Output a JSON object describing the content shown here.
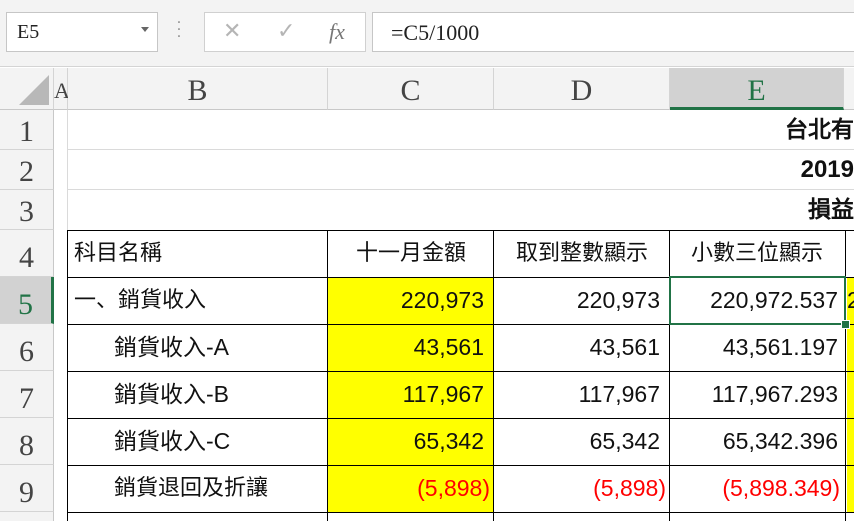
{
  "name_box": "E5",
  "formula_bar": {
    "cancel": "✕",
    "enter": "✓",
    "fx": "fx",
    "formula": "=C5/1000"
  },
  "columns": [
    "A",
    "B",
    "C",
    "D",
    "E"
  ],
  "rows": [
    "1",
    "2",
    "3",
    "4",
    "5",
    "6",
    "7",
    "8",
    "9"
  ],
  "titles": {
    "r1": "台北有",
    "r2": "2019",
    "r3": "損益"
  },
  "headers": {
    "b": "科目名稱",
    "c": "十一月金額",
    "d": "取到整數顯示",
    "e": "小數三位顯示"
  },
  "data_rows": [
    {
      "label": "一、銷貨收入",
      "c": "220,973",
      "d": "220,973",
      "e": "220,972.537",
      "negative": false
    },
    {
      "label": "銷貨收入-A",
      "c": "43,561",
      "d": "43,561",
      "e": "43,561.197",
      "negative": false
    },
    {
      "label": "銷貨收入-B",
      "c": "117,967",
      "d": "117,967",
      "e": "117,967.293",
      "negative": false
    },
    {
      "label": "銷貨收入-C",
      "c": "65,342",
      "d": "65,342",
      "e": "65,342.396",
      "negative": false
    },
    {
      "label": "銷貨退回及折讓",
      "c": "(5,898)",
      "d": "(5,898)",
      "e": "(5,898.349)",
      "negative": true
    }
  ],
  "row5_f_partial": "2",
  "colors": {
    "highlight": "#ffff00",
    "negative": "#ff0000",
    "selection": "#217346"
  }
}
